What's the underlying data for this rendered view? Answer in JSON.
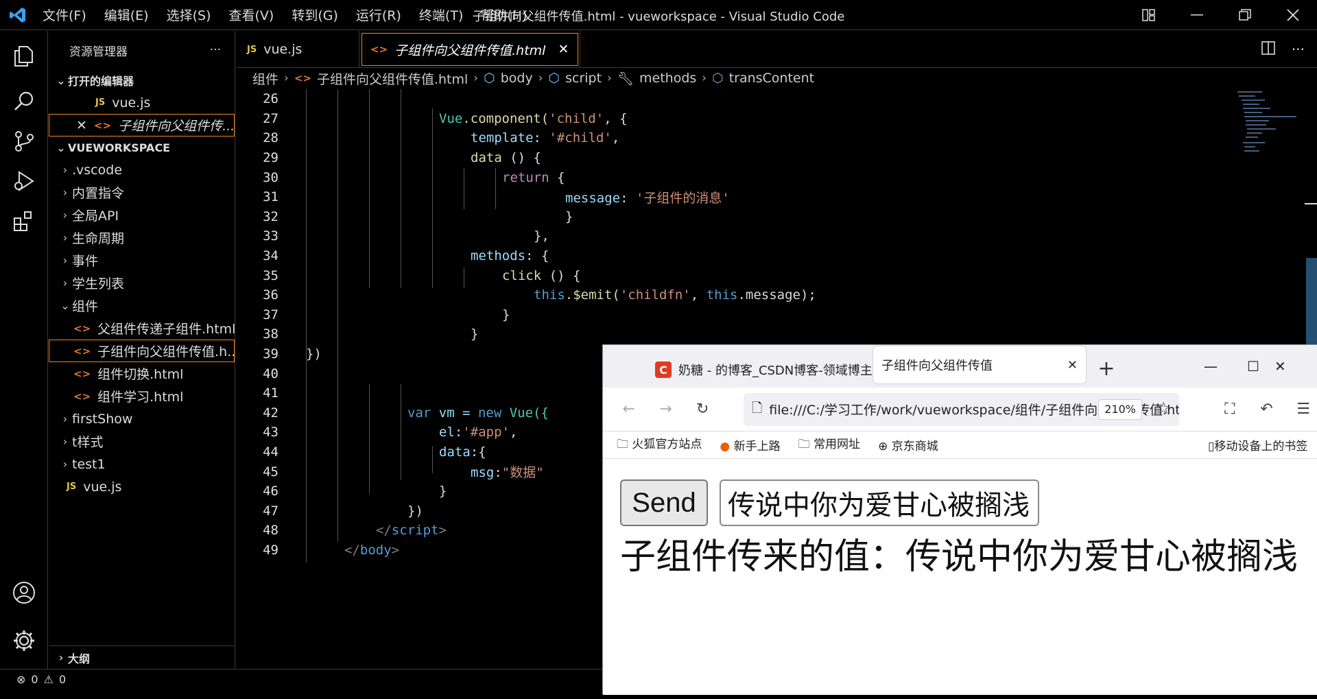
{
  "window": {
    "title": "子组件向父组件传值.html - vueworkspace - Visual Studio Code"
  },
  "menu": [
    "文件(F)",
    "编辑(E)",
    "选择(S)",
    "查看(V)",
    "转到(G)",
    "运行(R)",
    "终端(T)",
    "帮助(H)"
  ],
  "explorer": {
    "title": "资源管理器",
    "open_editors_label": "打开的编辑器",
    "open_editors": [
      {
        "name": "vue.js",
        "icon": "JS"
      },
      {
        "name": "子组件向父组件传...",
        "icon": "<>"
      }
    ],
    "workspace_label": "VUEWORKSPACE",
    "folders": [
      ".vscode",
      "内置指令",
      "全局API",
      "生命周期",
      "事件",
      "学生列表"
    ],
    "open_folder": "组件",
    "files": [
      "父组件传递子组件.html",
      "子组件向父组件传值.h...",
      "组件切换.html",
      "组件学习.html"
    ],
    "folders2": [
      "firstShow",
      "t样式",
      "test1"
    ],
    "root_file": "vue.js",
    "outline_label": "大纲"
  },
  "tabs": [
    {
      "label": "vue.js",
      "icon": "JS"
    },
    {
      "label": "子组件向父组件传值.html",
      "icon": "<>"
    }
  ],
  "breadcrumb": {
    "folder": "组件",
    "file": "子组件向父组件传值.html",
    "body": "body",
    "script": "script",
    "methods": "methods",
    "current": "transContent"
  },
  "code_lines": [
    "26",
    "27",
    "28",
    "29",
    "30",
    "31",
    "32",
    "33",
    "34",
    "35",
    "36",
    "37",
    "38",
    "39",
    "40",
    "41",
    "42",
    "43",
    "44",
    "45",
    "46",
    "47",
    "48",
    "49"
  ],
  "code": {
    "l27_a": "Vue",
    "l27_b": ".component(",
    "l27_c": "'child'",
    "l27_d": ", {",
    "l28_a": "template",
    "l28_b": ": ",
    "l28_c": "'#child'",
    "l28_d": ",",
    "l29_a": "data",
    "l29_b": " () {",
    "l30_a": "return",
    "l30_b": " {",
    "l31_a": "message",
    "l31_b": ": ",
    "l31_c": "'子组件的消息'",
    "l32": "}",
    "l33": "},",
    "l34_a": "methods",
    "l34_b": ": {",
    "l35_a": "click",
    "l35_b": " () {",
    "l36_a": "this",
    "l36_b": ".$emit(",
    "l36_c": "'childfn'",
    "l36_d": ", ",
    "l36_e": "this",
    "l36_f": ".message);",
    "l37": "}",
    "l38": "}",
    "l39": "})",
    "l42_a": "var",
    "l42_b": " vm = ",
    "l42_c": "new",
    "l42_d": " Vue({",
    "l43_a": "el",
    "l43_b": ":",
    "l43_c": "'#app'",
    "l43_d": ",",
    "l44_a": "data",
    "l44_b": ":{",
    "l45_a": "msg",
    "l45_b": ":",
    "l45_c": "\"数据\"",
    "l46": "}",
    "l47": "})",
    "l48_a": "</",
    "l48_b": "script",
    "l48_c": ">",
    "l49_a": "</",
    "l49_b": "body",
    "l49_c": ">"
  },
  "status": {
    "errors": "0",
    "warnings": "0"
  },
  "browser": {
    "tab1": "奶糖 - 的博客_CSDN博客-领域博主",
    "tab1_icon": "C",
    "tab2": "子组件向父组件传值",
    "url": "file:///C:/学习工作/work/vueworkspace/组件/子组件向父组件传值.html",
    "zoom": "210%",
    "bookmarks": [
      "火狐官方站点",
      "新手上路",
      "常用网址",
      "京东商城"
    ],
    "mobile_bookmarks": "移动设备上的书签",
    "send_label": "Send",
    "input_value": "传说中你为爱甘心被搁浅",
    "result_text": "子组件传来的值：传说中你为爱甘心被搁浅"
  }
}
